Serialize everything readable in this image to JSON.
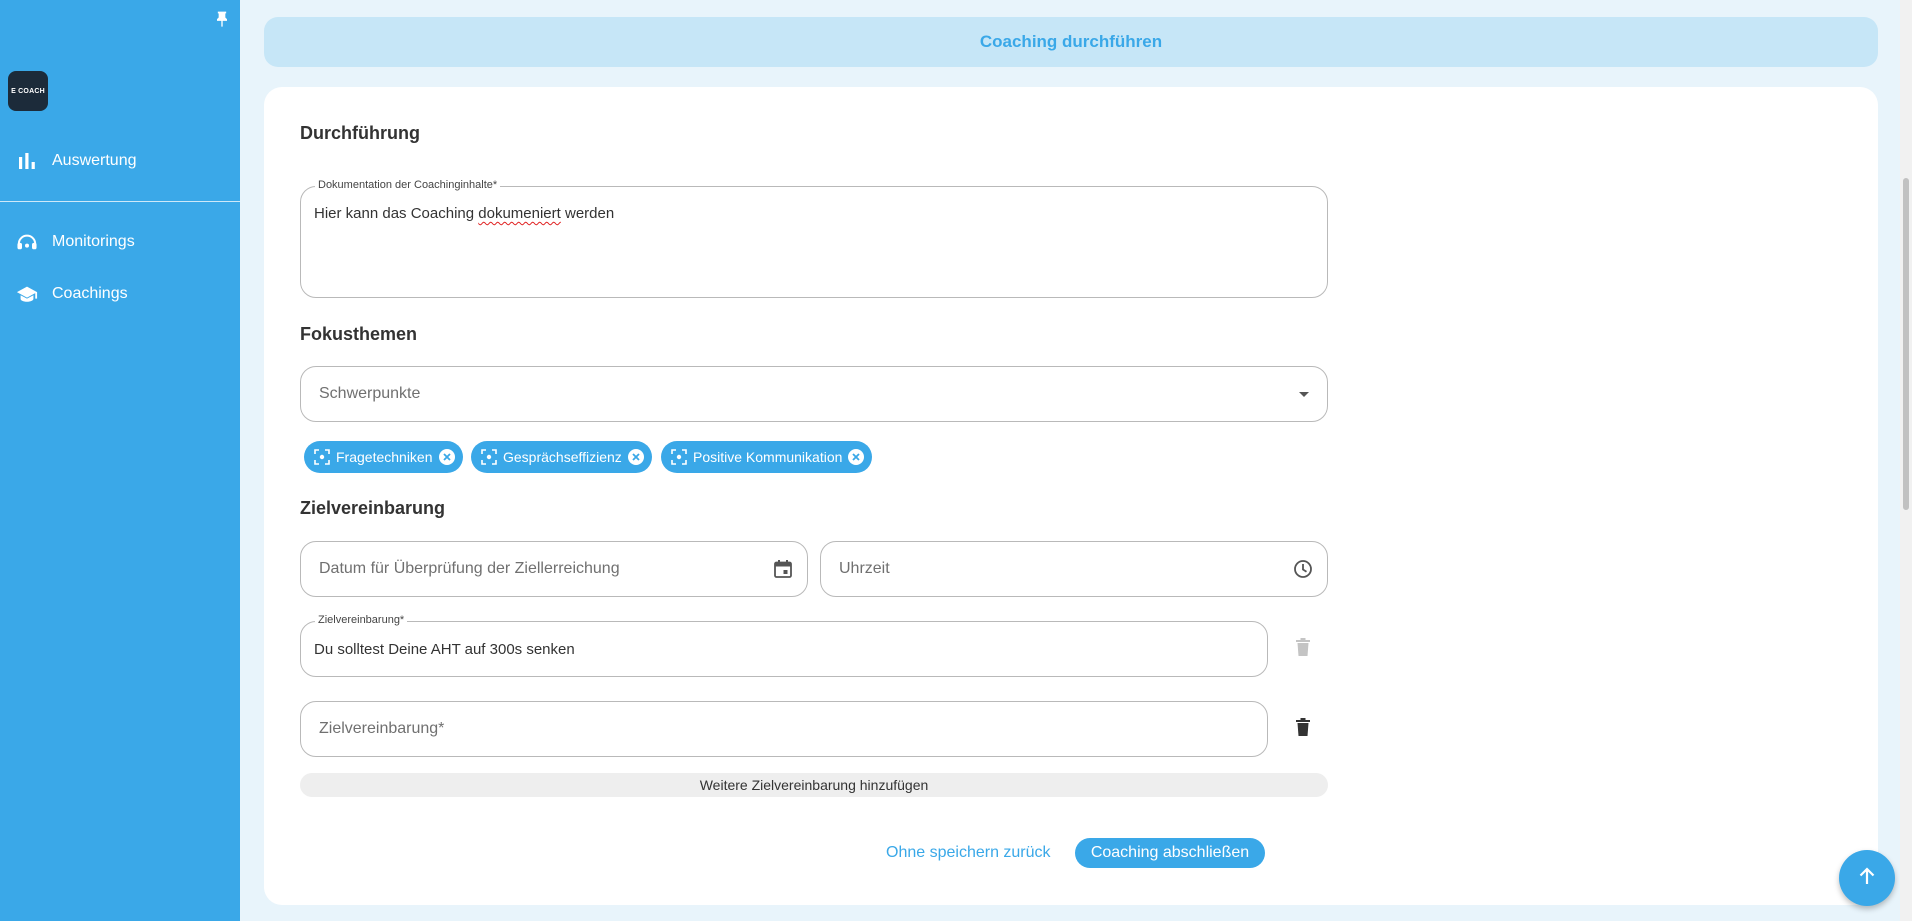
{
  "sidebar": {
    "logo_text": "E COACH",
    "items": [
      {
        "label": "Auswertung",
        "icon": "bar-chart-icon"
      },
      {
        "label": "Monitorings",
        "icon": "headset-icon"
      },
      {
        "label": "Coachings",
        "icon": "graduation-cap-icon"
      }
    ]
  },
  "header": {
    "title": "Coaching durchführen"
  },
  "durchfuehrung": {
    "title": "Durchführung",
    "doc_label": "Dokumentation der Coachinginhalte*",
    "doc_value_before": "Hier kann das Coaching ",
    "doc_value_misspelled": "dokumeniert",
    "doc_value_after": " werden"
  },
  "fokusthemen": {
    "title": "Fokusthemen",
    "select_placeholder": "Schwerpunkte",
    "chips": [
      "Fragetechniken",
      "Gesprächseffizienz",
      "Positive Kommunikation"
    ]
  },
  "zielvereinbarung": {
    "title": "Zielvereinbarung",
    "date_placeholder": "Datum für Überprüfung der Ziellerreichung",
    "time_placeholder": "Uhrzeit",
    "goal1_label": "Zielvereinbarung*",
    "goal1_value": "Du solltest Deine AHT auf 300s senken",
    "goal2_placeholder": "Zielvereinbarung*",
    "add_label": "Weitere Zielvereinbarung hinzufügen"
  },
  "actions": {
    "back_label": "Ohne speichern zurück",
    "finish_label": "Coaching abschließen"
  },
  "colors": {
    "primary": "#3aa8e8",
    "header_bg": "#c6e6f7",
    "page_bg": "#e8f4fb"
  }
}
